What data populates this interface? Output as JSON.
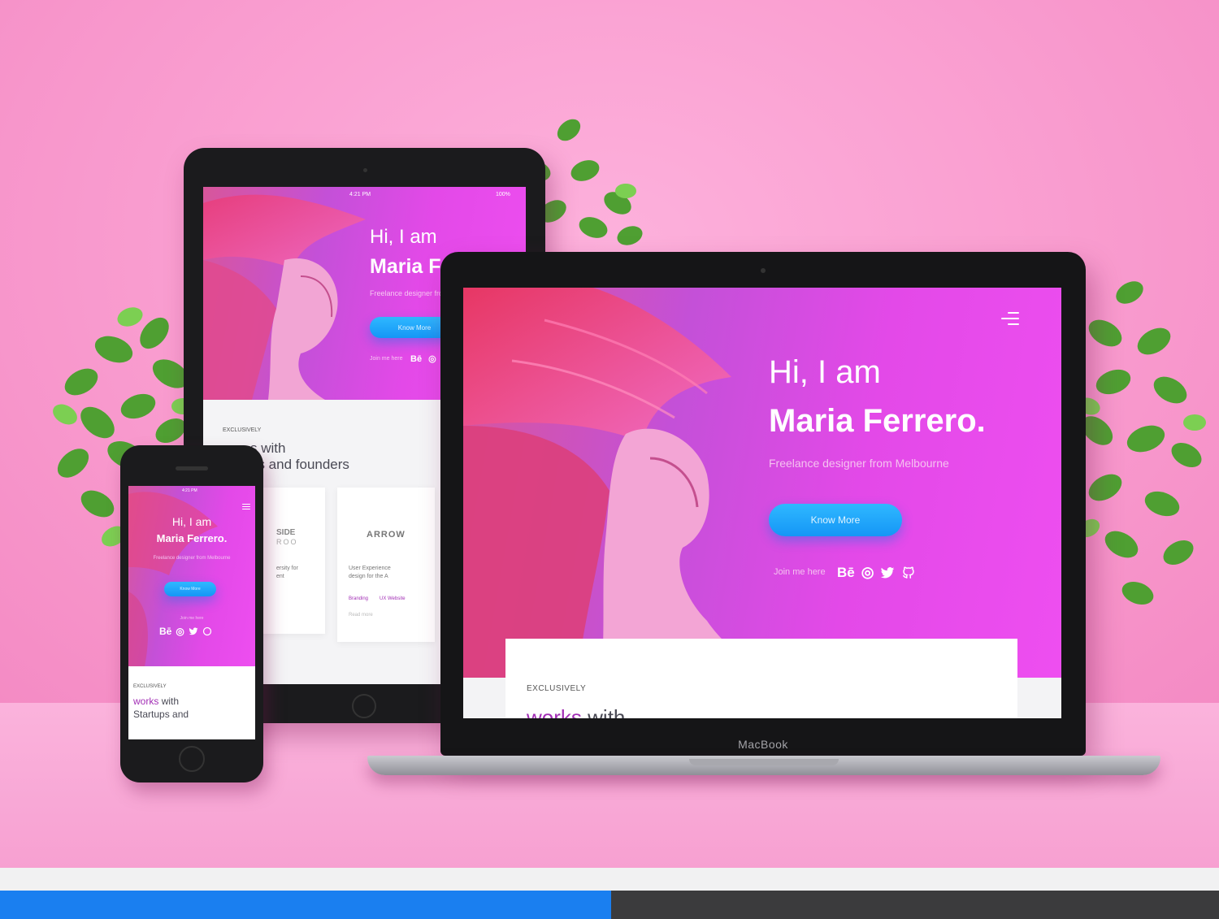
{
  "laptop": {
    "greeting": "Hi, I am",
    "name": "Maria Ferrero.",
    "tagline": "Freelance designer from Melbourne",
    "cta_label": "Know More",
    "social_label": "Join me here",
    "social_icons": [
      "behance-icon",
      "dribbble-icon",
      "twitter-icon",
      "github-icon"
    ],
    "section_eyebrow": "EXCLUSIVELY",
    "section_heading_accent": "works",
    "section_heading_rest": "with",
    "brand": "MacBook"
  },
  "tablet": {
    "status_time": "4:21 PM",
    "status_battery": "100%",
    "greeting": "Hi, I am",
    "name": "Maria F",
    "tagline": "Freelance designer from",
    "cta_label": "Know More",
    "social_label": "Join me here",
    "section_eyebrow": "EXCLUSIVELY",
    "section_heading_line1": "s with",
    "section_heading_line2": "ps and founders",
    "card1_logo": "SIDE",
    "card1_logo_sub": "ROO",
    "card1_text": "ersity for",
    "card1_text2": "ent",
    "card2_logo": "ARROW",
    "card2_text": "User Experience",
    "card2_text2": "design for the A",
    "card2_link_a": "Branding",
    "card2_link_b": "UX Website",
    "card2_more": "Read more"
  },
  "phone": {
    "status_time": "4:21 PM",
    "greeting": "Hi, I am",
    "name": "Maria Ferrero.",
    "tagline": "Freelance designer from Melbourne",
    "cta_label": "Know More",
    "social_label": "Join me here",
    "section_eyebrow": "EXCLUSIVELY",
    "section_heading_accent": "works",
    "section_heading_rest": "with",
    "section_heading_line2": "Startups and"
  },
  "colors": {
    "background_pink": "#f99ccf",
    "hero_magenta": "#e349e8",
    "cta_blue": "#1596f6",
    "accent_purple": "#a22fb5"
  }
}
